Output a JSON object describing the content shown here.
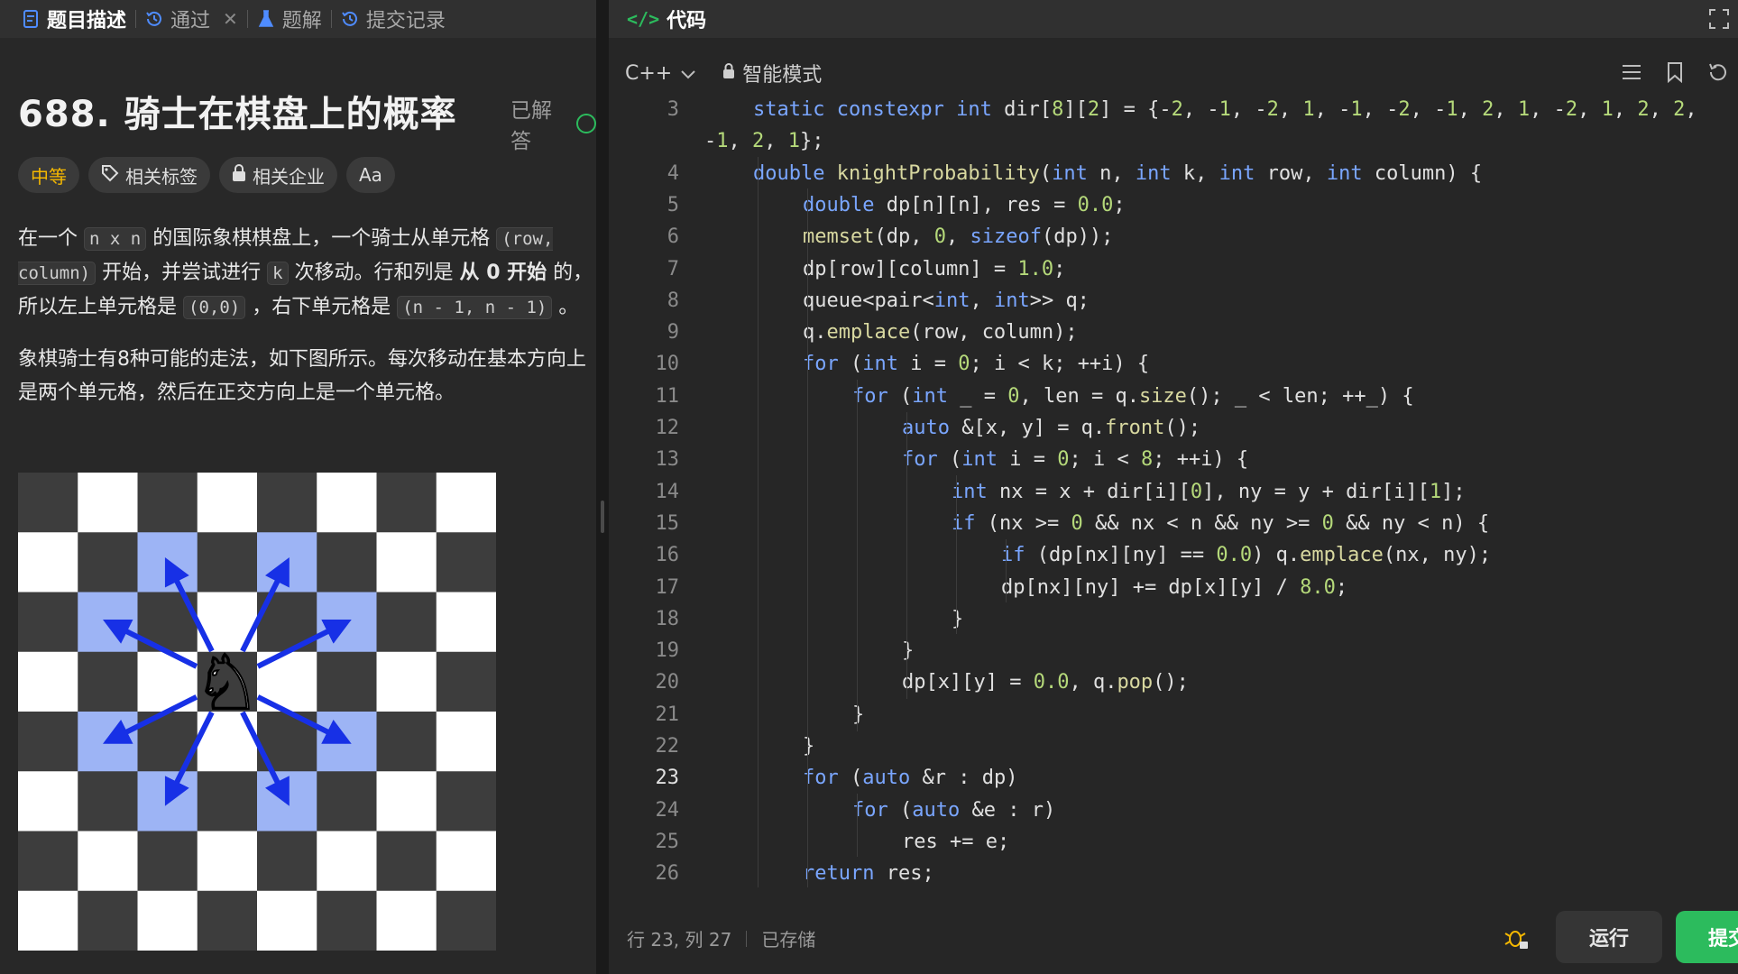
{
  "left_tabs": [
    {
      "label": "题目描述",
      "icon": "document-icon",
      "active": true
    },
    {
      "label": "通过",
      "icon": "history-icon",
      "closable": true
    },
    {
      "label": "题解",
      "icon": "flask-icon"
    },
    {
      "label": "提交记录",
      "icon": "history-icon"
    }
  ],
  "problem": {
    "title": "688. 骑士在棋盘上的概率",
    "solved_label": "已解答",
    "difficulty": "中等",
    "tags_label": "相关标签",
    "company_label": "相关企业",
    "font_label": "Aa",
    "para1": {
      "t1": "在一个 ",
      "c1": "n x n",
      "t2": " 的国际象棋棋盘上，一个骑士从单元格 ",
      "c2": "(row, column)",
      "t3": " 开始，并尝试进行 ",
      "c3": "k",
      "t4": " 次移动。行和列是 ",
      "b1": "从 0 开始",
      "t5": " 的，所以左上单元格是 ",
      "c4": "(0,0)",
      "t6": " ，右下单元格是 ",
      "c5": "(n - 1, n - 1)",
      "t7": " 。"
    },
    "para2": "象棋骑士有8种可能的走法，如下图所示。每次移动在基本方向上是两个单元格，然后在正交方向上是一个单元格。"
  },
  "editor": {
    "header": "代码",
    "language": "C++",
    "mode": "智能模式",
    "status_position": "行 23, 列 27",
    "status_saved": "已存储",
    "run_label": "运行",
    "submit_label": "提交"
  },
  "colors": {
    "accent_green": "#2cbb5d",
    "difficulty_yellow": "#f5b800",
    "keyword_blue": "#7aa6ff",
    "number_green": "#b5d97a",
    "board_dark": "#3d3d3d",
    "board_light": "#ffffff",
    "board_highlight": "#9db4f5",
    "arrow_blue": "#1730e6"
  }
}
